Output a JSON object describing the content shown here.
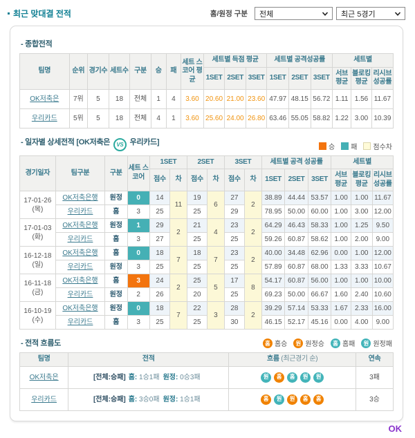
{
  "page": {
    "title": "최근 맞대결 전적",
    "filter_label": "홈/원정 구분",
    "select_home_away": "전체",
    "select_recent": "최근 5경기",
    "ok_link": "OK"
  },
  "colors": {
    "win": "#f3740e",
    "loss": "#45b0b5",
    "diff_bg": "#fcf8d7",
    "accent_teal": "#0f7f93",
    "orange_text": "#f0930f"
  },
  "summary": {
    "section_title": "- 종합전적",
    "headers": {
      "team": "팀명",
      "rank": "순위",
      "games": "경기수",
      "sets": "세트수",
      "division": "구분",
      "win": "승",
      "loss": "패",
      "set_score_avg": "세트 스코어 평균",
      "group_score": "세트별 득점 평균",
      "group_attack": "세트별 공격성공률",
      "group_setwise": "세트별",
      "set1": "1SET",
      "set2": "2SET",
      "set3": "3SET",
      "serve": "서브 평균",
      "block": "블로킹 평균",
      "receive": "리시브 성공률"
    },
    "rows": [
      {
        "team": "OK저축은",
        "rank": "7위",
        "games": "5",
        "sets": "18",
        "division": "전체",
        "win": "1",
        "loss": "4",
        "set_score_avg": "3.60",
        "score_avg": [
          "20.60",
          "21.00",
          "23.60"
        ],
        "attack": [
          "47.97",
          "48.15",
          "56.72"
        ],
        "serve": "1.11",
        "block": "1.56",
        "receive": "11.67"
      },
      {
        "team": "우리카드",
        "rank": "5위",
        "games": "5",
        "sets": "18",
        "division": "전체",
        "win": "4",
        "loss": "1",
        "set_score_avg": "3.60",
        "score_avg": [
          "25.60",
          "24.00",
          "26.80"
        ],
        "attack": [
          "63.46",
          "55.05",
          "58.82"
        ],
        "serve": "1.22",
        "block": "3.00",
        "receive": "10.39"
      }
    ]
  },
  "daily": {
    "section_title": "- 일자별 상세전적",
    "matchup_left": "[OK저축은",
    "vs": "VS",
    "matchup_right": "우리카드]",
    "legend": [
      {
        "label": "승",
        "type": "win"
      },
      {
        "label": "패",
        "type": "loss"
      },
      {
        "label": "점수차",
        "type": "diff"
      }
    ],
    "headers": {
      "date": "경기일자",
      "team": "팀구분",
      "division": "구분",
      "set_score": "세트 스코어",
      "set1": "1SET",
      "set2": "2SET",
      "set3": "3SET",
      "attack_group": "세트별 공격 성공률",
      "setwise_group": "세트별",
      "score": "점수",
      "diff": "차",
      "a1": "1SET",
      "a2": "2SET",
      "a3": "3SET",
      "serve": "서브 평균",
      "block": "블로킹 평균",
      "receive": "리시브 성공률"
    },
    "games": [
      {
        "date": "17-01-26",
        "day": "(목)",
        "diffs": [
          "11",
          "6",
          "2"
        ],
        "rows": [
          {
            "team": "OK저축은행",
            "division": "원정",
            "set_score": "0",
            "score_type": "loss",
            "scores": [
              "14",
              "19",
              "27"
            ],
            "attack": [
              "38.89",
              "44.44",
              "53.57"
            ],
            "serve": "1.00",
            "block": "1.00",
            "receive": "11.67"
          },
          {
            "team": "우리카드",
            "division": "홈",
            "set_score": "3",
            "score_type": "none",
            "scores": [
              "25",
              "25",
              "29"
            ],
            "attack": [
              "78.95",
              "50.00",
              "60.00"
            ],
            "serve": "1.00",
            "block": "3.00",
            "receive": "12.00"
          }
        ]
      },
      {
        "date": "17-01-03",
        "day": "(화)",
        "diffs": [
          "2",
          "4",
          "2"
        ],
        "rows": [
          {
            "team": "OK저축은행",
            "division": "원정",
            "set_score": "1",
            "score_type": "loss",
            "scores": [
              "29",
              "21",
              "23"
            ],
            "attack": [
              "64.29",
              "46.43",
              "58.33"
            ],
            "serve": "1.00",
            "block": "1.25",
            "receive": "9.50"
          },
          {
            "team": "우리카드",
            "division": "홈",
            "set_score": "3",
            "score_type": "none",
            "scores": [
              "27",
              "25",
              "25"
            ],
            "attack": [
              "59.26",
              "60.87",
              "58.62"
            ],
            "serve": "1.00",
            "block": "2.00",
            "receive": "9.00"
          }
        ]
      },
      {
        "date": "16-12-18",
        "day": "(일)",
        "diffs": [
          "7",
          "7",
          "2"
        ],
        "rows": [
          {
            "team": "OK저축은행",
            "division": "홈",
            "set_score": "0",
            "score_type": "loss",
            "scores": [
              "18",
              "18",
              "23"
            ],
            "attack": [
              "40.00",
              "34.48",
              "62.96"
            ],
            "serve": "0.00",
            "block": "1.00",
            "receive": "12.00"
          },
          {
            "team": "우리카드",
            "division": "원정",
            "set_score": "3",
            "score_type": "none",
            "scores": [
              "25",
              "25",
              "25"
            ],
            "attack": [
              "57.89",
              "60.87",
              "68.00"
            ],
            "serve": "1.33",
            "block": "3.33",
            "receive": "10.67"
          }
        ]
      },
      {
        "date": "16-11-18",
        "day": "(금)",
        "diffs": [
          "2",
          "5",
          "8"
        ],
        "rows": [
          {
            "team": "OK저축은행",
            "division": "홈",
            "set_score": "3",
            "score_type": "win",
            "scores": [
              "24",
              "25",
              "17"
            ],
            "attack": [
              "54.17",
              "60.87",
              "56.00"
            ],
            "serve": "1.00",
            "block": "1.00",
            "receive": "10.00"
          },
          {
            "team": "우리카드",
            "division": "원정",
            "set_score": "2",
            "score_type": "none",
            "scores": [
              "26",
              "20",
              "25"
            ],
            "attack": [
              "69.23",
              "50.00",
              "66.67"
            ],
            "serve": "1.60",
            "block": "2.40",
            "receive": "10.60"
          }
        ]
      },
      {
        "date": "16-10-19",
        "day": "(수)",
        "diffs": [
          "7",
          "3",
          "2"
        ],
        "rows": [
          {
            "team": "OK저축은행",
            "division": "원정",
            "set_score": "0",
            "score_type": "loss",
            "scores": [
              "18",
              "22",
              "28"
            ],
            "attack": [
              "39.29",
              "57.14",
              "53.33"
            ],
            "serve": "1.67",
            "block": "2.33",
            "receive": "16.00"
          },
          {
            "team": "우리카드",
            "division": "홈",
            "set_score": "3",
            "score_type": "none",
            "scores": [
              "25",
              "25",
              "30"
            ],
            "attack": [
              "46.15",
              "52.17",
              "45.16"
            ],
            "serve": "0.00",
            "block": "4.00",
            "receive": "9.00"
          }
        ]
      }
    ]
  },
  "flow": {
    "section_title": "- 전적 흐름도",
    "legend": [
      {
        "badge": "홈",
        "type": "win",
        "label": "홈승"
      },
      {
        "badge": "원",
        "type": "win",
        "label": "원정승"
      },
      {
        "badge": "홈",
        "type": "loss",
        "label": "홈패"
      },
      {
        "badge": "원",
        "type": "loss",
        "label": "원정패"
      }
    ],
    "headers": {
      "team": "팀명",
      "record": "전적",
      "flow": "흐름",
      "flow_sub": "(최근경기 순)",
      "streak": "연속"
    },
    "rows": [
      {
        "team": "OK저축은",
        "record_total": "[전체:승패]",
        "home_label": "홈:",
        "home": "1승1패",
        "away_label": "원정:",
        "away": "0승3패",
        "flow": [
          {
            "badge": "원",
            "type": "loss"
          },
          {
            "badge": "홈",
            "type": "win"
          },
          {
            "badge": "홈",
            "type": "loss"
          },
          {
            "badge": "원",
            "type": "loss"
          },
          {
            "badge": "원",
            "type": "loss"
          }
        ],
        "streak": "3패"
      },
      {
        "team": "우리카드",
        "record_total": "[전체:승패]",
        "home_label": "홈:",
        "home": "3승0패",
        "away_label": "원정:",
        "away": "1승1패",
        "flow": [
          {
            "badge": "홈",
            "type": "win"
          },
          {
            "badge": "원",
            "type": "loss"
          },
          {
            "badge": "원",
            "type": "win"
          },
          {
            "badge": "홈",
            "type": "win"
          },
          {
            "badge": "홈",
            "type": "win"
          }
        ],
        "streak": "3승"
      }
    ]
  }
}
